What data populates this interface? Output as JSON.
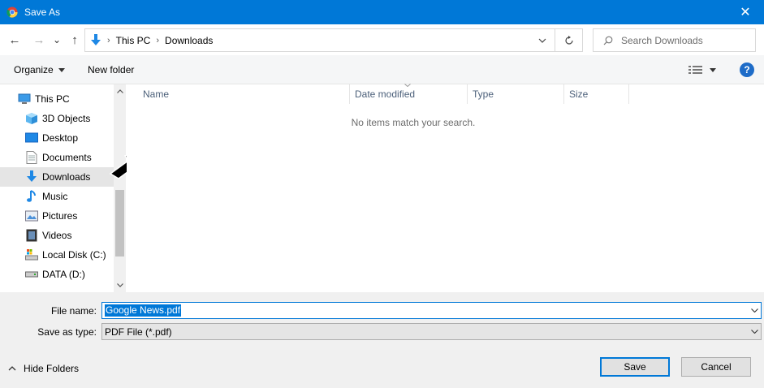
{
  "window": {
    "title": "Save As",
    "close_glyph": "✕"
  },
  "nav": {
    "back_glyph": "←",
    "forward_glyph": "→",
    "recent_glyph": "⌄",
    "up_glyph": "↑",
    "path": [
      "This PC",
      "Downloads"
    ],
    "path_separator": "›",
    "search_placeholder": "Search Downloads"
  },
  "toolbar": {
    "organize_label": "Organize",
    "new_folder_label": "New folder",
    "help_glyph": "?"
  },
  "sidebar": {
    "items": [
      {
        "label": "This PC",
        "icon": "computer-icon"
      },
      {
        "label": "3D Objects",
        "icon": "cube-icon"
      },
      {
        "label": "Desktop",
        "icon": "desktop-icon"
      },
      {
        "label": "Documents",
        "icon": "document-icon"
      },
      {
        "label": "Downloads",
        "icon": "download-icon",
        "selected": true
      },
      {
        "label": "Music",
        "icon": "music-icon"
      },
      {
        "label": "Pictures",
        "icon": "pictures-icon"
      },
      {
        "label": "Videos",
        "icon": "videos-icon"
      },
      {
        "label": "Local Disk (C:)",
        "icon": "disk-icon"
      },
      {
        "label": "DATA (D:)",
        "icon": "drive-icon"
      }
    ]
  },
  "columns": [
    "Name",
    "Date modified",
    "Type",
    "Size"
  ],
  "empty_message": "No items match your search.",
  "form": {
    "file_name_label": "File name:",
    "file_name_value": "Google News.pdf",
    "save_type_label": "Save as type:",
    "save_type_value": "PDF File (*.pdf)"
  },
  "footer": {
    "hide_folders_label": "Hide Folders",
    "save_label": "Save",
    "cancel_label": "Cancel"
  },
  "colors": {
    "titlebar": "#0078d7",
    "selected_row": "#e5e5e5",
    "accent": "#0078d7"
  }
}
